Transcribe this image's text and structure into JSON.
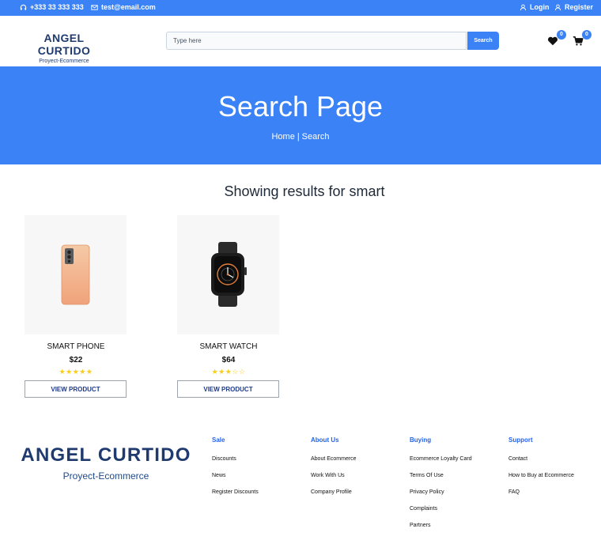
{
  "topbar": {
    "phone": "+333 33 333 333",
    "email": "test@email.com",
    "login": "Login",
    "register": "Register",
    "background": "#3b82f6"
  },
  "header": {
    "brand": "ANGEL CURTIDO",
    "brand_sub": "Proyect-Ecommerce",
    "search_placeholder": "Type here",
    "search_button": "Search",
    "wishlist_count": "0",
    "cart_count": "0"
  },
  "hero": {
    "title": "Search Page",
    "breadcrumb_home": "Home",
    "breadcrumb_separator": "|",
    "breadcrumb_current": "Search"
  },
  "results": {
    "heading": "Showing results for smart",
    "products": [
      {
        "name": "SMART PHONE",
        "price": "$22",
        "rating": 5,
        "rating_text": "★★★★★",
        "button": "VIEW PRODUCT",
        "icon": "smartphone-icon"
      },
      {
        "name": "SMART WATCH",
        "price": "$64",
        "rating": 3,
        "rating_text": "★★★☆☆",
        "button": "VIEW PRODUCT",
        "icon": "smartwatch-icon"
      }
    ]
  },
  "footer": {
    "brand": "ANGEL CURTIDO",
    "brand_sub": "Proyect-Ecommerce",
    "columns": [
      {
        "title": "Sale",
        "links": [
          "Discounts",
          "News",
          "Register Discounts"
        ]
      },
      {
        "title": "About Us",
        "links": [
          "About Ecommerce",
          "Work With Us",
          "Company Profile"
        ]
      },
      {
        "title": "Buying",
        "links": [
          "Ecommerce Loyalty Card",
          "Terms Of Use",
          "Privacy Policy",
          "Complaints",
          "Partners"
        ]
      },
      {
        "title": "Support",
        "links": [
          "Contact",
          "How to Buy at Ecommerce",
          "FAQ"
        ]
      }
    ]
  },
  "colors": {
    "accent": "#3b82f6",
    "brand": "#1e3a6e",
    "star": "#facc15"
  }
}
